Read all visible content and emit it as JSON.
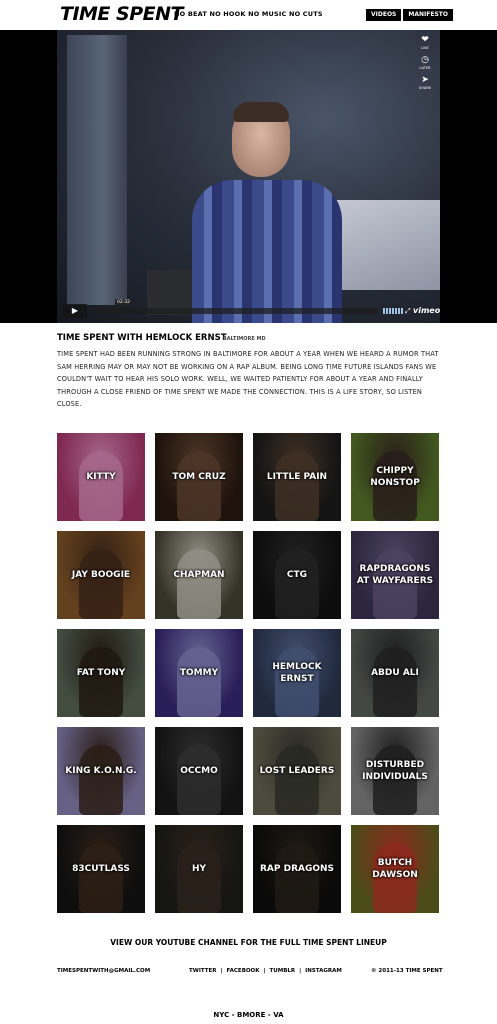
{
  "header": {
    "logo": "TIME SPENT",
    "tagline": "NO BEAT NO HOOK NO MUSIC NO CUTS",
    "nav": [
      "VIDEOS",
      "MANIFESTO"
    ]
  },
  "video": {
    "side_icons": [
      {
        "icon": "heart-icon",
        "label": "LIKE"
      },
      {
        "icon": "clock-icon",
        "label": "LATER"
      },
      {
        "icon": "share-icon",
        "label": "SHARE"
      }
    ],
    "time": "02:32",
    "brand": "vimeo",
    "progress": 0.0
  },
  "info": {
    "title": "TIME SPENT WITH HEMLOCK ERNST",
    "location": "BALTIMORE MD",
    "description": "TIME SPENT HAD BEEN RUNNING STRONG IN BALTIMORE FOR ABOUT A YEAR WHEN WE HEARD A RUMOR THAT SAM HERRING MAY OR MAY NOT BE WORKING ON A RAP ALBUM. BEING LONG TIME FUTURE ISLANDS FANS WE COULDN'T WAIT TO HEAR HIS SOLO WORK. WELL, WE WAITED PATIENTLY FOR ABOUT A YEAR AND FINALLY THROUGH A CLOSE FRIEND OF TIME SPENT WE MADE THE CONNECTION. THIS IS A LIFE STORY, SO LISTEN CLOSE."
  },
  "artists": [
    {
      "name": "KITTY",
      "bg": "#b0386f",
      "fig": "#e48fc0"
    },
    {
      "name": "TOM CRUZ",
      "bg": "#2a1a12",
      "fig": "#6b4a36"
    },
    {
      "name": "LITTLE PAIN",
      "bg": "#1c1c1c",
      "fig": "#574233"
    },
    {
      "name": "CHIPPY NONSTOP",
      "bg": "#5b7a2c",
      "fig": "#3a2a24"
    },
    {
      "name": "JAY BOOGIE",
      "bg": "#8a5a2a",
      "fig": "#4a2e1e"
    },
    {
      "name": "CHAPMAN",
      "bg": "#4a4636",
      "fig": "#c9c6b8"
    },
    {
      "name": "CTG",
      "bg": "#121212",
      "fig": "#2e2e2e"
    },
    {
      "name": "RAPDRAGONS AT WAYFARERS",
      "bg": "#3c3555",
      "fig": "#6a5d86"
    },
    {
      "name": "FAT TONY",
      "bg": "#5c6a58",
      "fig": "#2d2218"
    },
    {
      "name": "TOMMY",
      "bg": "#3a2b7a",
      "fig": "#8e88c8"
    },
    {
      "name": "HEMLOCK ERNST",
      "bg": "#2e3a55",
      "fig": "#5b6d9a"
    },
    {
      "name": "ABDU ALI",
      "bg": "#5e6460",
      "fig": "#2b2b2b"
    },
    {
      "name": "KING K.O.N.G.",
      "bg": "#8e86b8",
      "fig": "#3b2a20"
    },
    {
      "name": "OCCMO",
      "bg": "#1a1a1a",
      "fig": "#3e3e3e"
    },
    {
      "name": "LOST LEADERS",
      "bg": "#6a6a56",
      "fig": "#3a3a32"
    },
    {
      "name": "DISTURBED INDIVIDUALS",
      "bg": "#8a8a8a",
      "fig": "#2c2c2c"
    },
    {
      "name": "83CUTLASS",
      "bg": "#141414",
      "fig": "#3d2c1f"
    },
    {
      "name": "HY",
      "bg": "#1e1e1a",
      "fig": "#3b2e24"
    },
    {
      "name": "RAP DRAGONS",
      "bg": "#0e0e0e",
      "fig": "#2c241c"
    },
    {
      "name": "BUTCH DAWSON",
      "bg": "#6a6a22",
      "fig": "#c23a2a"
    }
  ],
  "footer": {
    "youtube": "VIEW OUR YOUTUBE CHANNEL FOR THE FULL TIME SPENT LINEUP",
    "email": "TIMESPENTWITH@GMAIL.COM",
    "links": [
      "TWITTER",
      "FACEBOOK",
      "TUMBLR",
      "INSTAGRAM"
    ],
    "copyright": "© 2011-13 TIME SPENT",
    "location": "NYC - BMORE - VA"
  }
}
